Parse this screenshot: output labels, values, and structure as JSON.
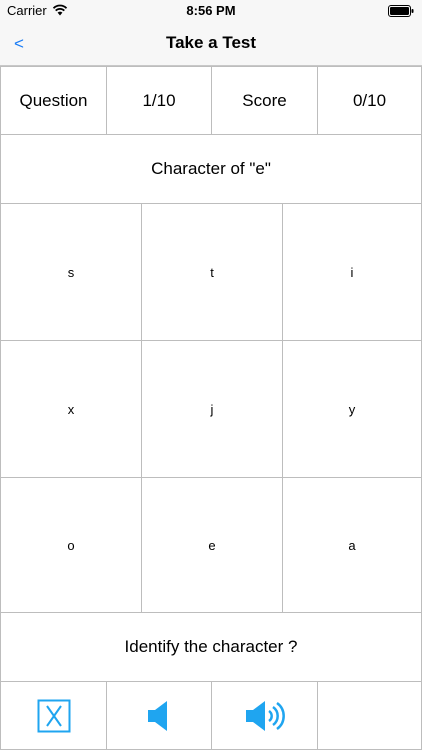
{
  "status_bar": {
    "carrier": "Carrier",
    "time": "8:56 PM"
  },
  "nav": {
    "back_label": "<",
    "title": "Take a Test"
  },
  "scoreboard": {
    "question_label": "Question",
    "question_value": "1/10",
    "score_label": "Score",
    "score_value": "0/10"
  },
  "prompt": "Character of \"e\"",
  "choices": [
    [
      "s",
      "t",
      "i"
    ],
    [
      "x",
      "j",
      "y"
    ],
    [
      "o",
      "e",
      "a"
    ]
  ],
  "instruction": "Identify the character ?",
  "toolbar": {
    "icons": [
      "close-box-icon",
      "speaker-icon",
      "speaker-loud-icon"
    ],
    "accent_color": "#1fa5f0"
  }
}
